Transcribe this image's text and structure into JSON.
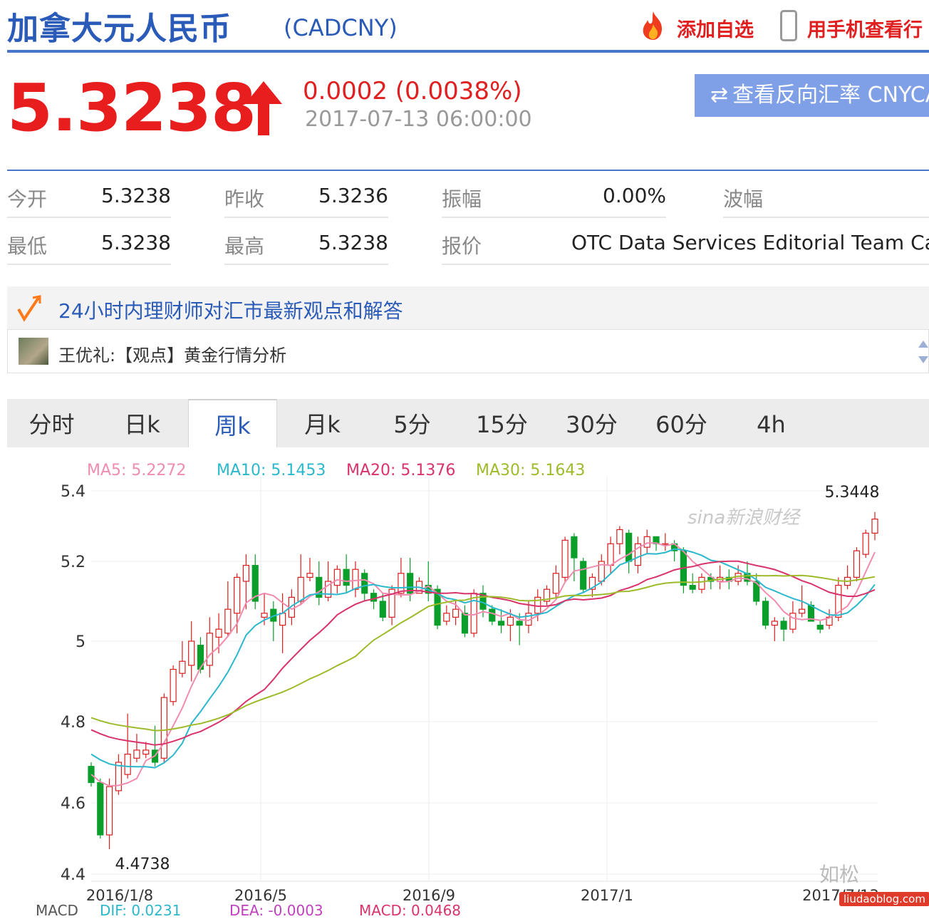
{
  "header": {
    "title": "加拿大元人民币",
    "code": "(CADCNY)",
    "add_watchlist": "添加自选",
    "mobile_view": "用手机查看行"
  },
  "quote": {
    "price": "5.3238",
    "change": "0.0002 (0.0038%)",
    "timestamp": "2017-07-13 06:00:00",
    "reverse_button": "查看反向汇率 CNYCA",
    "up_color": "#e81d1d"
  },
  "stats": {
    "open_label": "今开",
    "open": "5.3238",
    "prev_close_label": "昨收",
    "prev_close": "5.3236",
    "amplitude_label": "振幅",
    "amplitude": "0.00%",
    "wave_label": "波幅",
    "wave": "",
    "low_label": "最低",
    "low": "5.3238",
    "high_label": "最高",
    "high": "5.3238",
    "quote_label": "报价",
    "quote_source": "OTC Data Services Editorial Team Calc"
  },
  "news": {
    "heading": "24小时内理财师对汇市最新观点和解答",
    "item": "王优礼:【观点】黄金行情分析"
  },
  "tabs": [
    {
      "label": "分时"
    },
    {
      "label": "日k"
    },
    {
      "label": "周k"
    },
    {
      "label": "月k"
    },
    {
      "label": "5分"
    },
    {
      "label": "15分"
    },
    {
      "label": "30分"
    },
    {
      "label": "60分"
    },
    {
      "label": "4h"
    }
  ],
  "active_tab": "周k",
  "legend": {
    "ma5": "MA5: 5.2272",
    "ma10": "MA10: 5.1453",
    "ma20": "MA20: 5.1376",
    "ma30": "MA30: 5.1643"
  },
  "macd_legend": {
    "macd_label": "MACD",
    "dif": "DIF: 0.0231",
    "dea": "DEA: -0.0003",
    "macd": "MACD: 0.0468"
  },
  "watermarks": {
    "chart_brand": "sina新浪财经",
    "author": "如松",
    "site": "liudaoblog.com"
  },
  "chart_data": {
    "type": "candlestick",
    "y_ticks": [
      "5.4",
      "5.2",
      "5",
      "4.8",
      "4.6",
      "4.4"
    ],
    "y_tick_values": [
      5.4,
      5.2,
      5.0,
      4.8,
      4.6,
      4.4
    ],
    "x_labels": [
      "2016/1/8",
      "2016/5",
      "2016/9",
      "2017/1",
      "2017/7/13"
    ],
    "max_label": "5.3448",
    "min_label": "4.4738",
    "colors": {
      "up": "#d81e1e",
      "down": "#0a9e2a",
      "ma5": "#f08cb0",
      "ma10": "#2bb8cc",
      "ma20": "#d8336a",
      "ma30": "#9dbb2a"
    },
    "candles": [
      [
        4.69,
        4.65,
        4.7,
        4.64
      ],
      [
        4.65,
        4.51,
        4.66,
        4.5
      ],
      [
        4.51,
        4.64,
        4.66,
        4.47
      ],
      [
        4.63,
        4.7,
        4.72,
        4.62
      ],
      [
        4.67,
        4.72,
        4.82,
        4.66
      ],
      [
        4.71,
        4.73,
        4.77,
        4.7
      ],
      [
        4.72,
        4.73,
        4.75,
        4.71
      ],
      [
        4.73,
        4.7,
        4.79,
        4.69
      ],
      [
        4.71,
        4.86,
        4.87,
        4.7
      ],
      [
        4.85,
        4.93,
        4.94,
        4.84
      ],
      [
        4.92,
        4.95,
        5.0,
        4.91
      ],
      [
        4.94,
        5.0,
        5.05,
        4.9
      ],
      [
        4.99,
        4.93,
        5.01,
        4.92
      ],
      [
        4.94,
        5.02,
        5.06,
        4.91
      ],
      [
        5.01,
        5.03,
        5.07,
        4.97
      ],
      [
        5.02,
        5.08,
        5.15,
        5.01
      ],
      [
        5.07,
        5.16,
        5.17,
        5.02
      ],
      [
        5.15,
        5.19,
        5.22,
        5.08
      ],
      [
        5.19,
        5.1,
        5.22,
        5.08
      ],
      [
        5.06,
        5.07,
        5.12,
        5.04
      ],
      [
        5.08,
        5.05,
        5.1,
        5.0
      ],
      [
        5.04,
        5.07,
        5.12,
        4.97
      ],
      [
        5.06,
        5.11,
        5.13,
        5.04
      ],
      [
        5.1,
        5.16,
        5.22,
        5.09
      ],
      [
        5.16,
        5.17,
        5.21,
        5.15
      ],
      [
        5.16,
        5.11,
        5.2,
        5.09
      ],
      [
        5.11,
        5.15,
        5.2,
        5.1
      ],
      [
        5.14,
        5.18,
        5.19,
        5.12
      ],
      [
        5.18,
        5.14,
        5.22,
        5.12
      ],
      [
        5.13,
        5.18,
        5.2,
        5.11
      ],
      [
        5.17,
        5.12,
        5.18,
        5.1
      ],
      [
        5.12,
        5.1,
        5.13,
        5.08
      ],
      [
        5.1,
        5.06,
        5.12,
        5.05
      ],
      [
        5.06,
        5.13,
        5.14,
        5.04
      ],
      [
        5.12,
        5.17,
        5.21,
        5.11
      ],
      [
        5.17,
        5.12,
        5.21,
        5.1
      ],
      [
        5.12,
        5.15,
        5.16,
        5.12
      ],
      [
        5.14,
        5.12,
        5.2,
        5.1
      ],
      [
        5.13,
        5.04,
        5.14,
        5.03
      ],
      [
        5.05,
        5.07,
        5.09,
        5.04
      ],
      [
        5.06,
        5.08,
        5.1,
        5.04
      ],
      [
        5.07,
        5.02,
        5.09,
        5.01
      ],
      [
        5.02,
        5.12,
        5.13,
        5.01
      ],
      [
        5.12,
        5.08,
        5.14,
        5.06
      ],
      [
        5.08,
        5.05,
        5.09,
        5.04
      ],
      [
        5.05,
        5.04,
        5.08,
        5.02
      ],
      [
        5.04,
        5.06,
        5.08,
        5.0
      ],
      [
        5.05,
        5.04,
        5.07,
        4.99
      ],
      [
        5.04,
        5.07,
        5.1,
        5.02
      ],
      [
        5.07,
        5.11,
        5.13,
        5.05
      ],
      [
        5.1,
        5.13,
        5.14,
        5.09
      ],
      [
        5.12,
        5.17,
        5.19,
        5.11
      ],
      [
        5.16,
        5.26,
        5.27,
        5.15
      ],
      [
        5.27,
        5.21,
        5.28,
        5.15
      ],
      [
        5.2,
        5.13,
        5.21,
        5.12
      ],
      [
        5.13,
        5.16,
        5.17,
        5.11
      ],
      [
        5.15,
        5.2,
        5.22,
        5.14
      ],
      [
        5.19,
        5.25,
        5.27,
        5.17
      ],
      [
        5.25,
        5.29,
        5.3,
        5.22
      ],
      [
        5.28,
        5.2,
        5.29,
        5.17
      ],
      [
        5.19,
        5.25,
        5.27,
        5.17
      ],
      [
        5.24,
        5.27,
        5.29,
        5.22
      ],
      [
        5.27,
        5.25,
        5.27,
        5.23
      ],
      [
        5.25,
        5.25,
        5.28,
        5.23
      ],
      [
        5.25,
        5.23,
        5.26,
        5.2
      ],
      [
        5.23,
        5.14,
        5.24,
        5.12
      ],
      [
        5.14,
        5.13,
        5.17,
        5.12
      ],
      [
        5.13,
        5.16,
        5.17,
        5.12
      ],
      [
        5.16,
        5.15,
        5.17,
        5.13
      ],
      [
        5.15,
        5.16,
        5.19,
        5.13
      ],
      [
        5.16,
        5.15,
        5.18,
        5.13
      ],
      [
        5.15,
        5.17,
        5.19,
        5.14
      ],
      [
        5.17,
        5.15,
        5.2,
        5.14
      ],
      [
        5.15,
        5.1,
        5.17,
        5.09
      ],
      [
        5.1,
        5.04,
        5.11,
        5.03
      ],
      [
        5.04,
        5.05,
        5.06,
        5.0
      ],
      [
        5.05,
        5.03,
        5.06,
        5.0
      ],
      [
        5.03,
        5.07,
        5.1,
        5.02
      ],
      [
        5.07,
        5.08,
        5.14,
        5.06
      ],
      [
        5.09,
        5.05,
        5.1,
        5.05
      ],
      [
        5.04,
        5.03,
        5.05,
        5.02
      ],
      [
        5.04,
        5.06,
        5.08,
        5.03
      ],
      [
        5.06,
        5.14,
        5.16,
        5.05
      ],
      [
        5.14,
        5.16,
        5.19,
        5.13
      ],
      [
        5.16,
        5.23,
        5.24,
        5.15
      ],
      [
        5.22,
        5.28,
        5.29,
        5.21
      ],
      [
        5.28,
        5.32,
        5.34,
        5.26
      ]
    ]
  }
}
